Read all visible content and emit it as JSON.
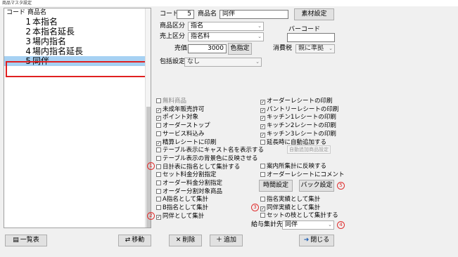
{
  "window_title": "商品マスタ設定",
  "list": {
    "header_code": "コード",
    "header_name": "商品名",
    "rows": [
      {
        "code": "1",
        "name": "本指名"
      },
      {
        "code": "2",
        "name": "本指名延長"
      },
      {
        "code": "3",
        "name": "場内指名"
      },
      {
        "code": "4",
        "name": "場内指名延長"
      },
      {
        "code": "5",
        "name": "同伴"
      }
    ],
    "selected_code": "5"
  },
  "form": {
    "code_label": "コード",
    "code_value": "5",
    "name_label": "商品名",
    "name_value": "同伴",
    "material_button": "素材設定",
    "category_label": "商品区分",
    "category_value": "指名",
    "sales_label": "売上区分",
    "sales_value": "指名料",
    "barcode_label": "バーコード",
    "barcode_value": "",
    "price_label": "売価",
    "price_value": "3000",
    "color_button": "色指定",
    "tax_label": "消費税",
    "tax_value": "親に準拠",
    "package_label": "包括設定",
    "package_value": "なし"
  },
  "checks_left": [
    {
      "label": "無料商品",
      "checked": false,
      "disabled": true
    },
    {
      "label": "未成年販売許可",
      "checked": true,
      "disabled": false
    },
    {
      "label": "ポイント対象",
      "checked": true,
      "disabled": false
    },
    {
      "label": "オーダーストップ",
      "checked": false,
      "disabled": false
    },
    {
      "label": "サービス料込み",
      "checked": false,
      "disabled": false
    },
    {
      "label": "精算レシートに印刷",
      "checked": true,
      "disabled": false
    },
    {
      "label": "テーブル表示にキャスト名を表示する",
      "checked": false,
      "disabled": false
    },
    {
      "label": "テーブル表示の背景色に反映させる",
      "checked": false,
      "disabled": false
    },
    {
      "label": "日計表に指名として集計する",
      "checked": false,
      "disabled": false
    },
    {
      "label": "セット料金分割指定",
      "checked": false,
      "disabled": false
    },
    {
      "label": "オーダー料金分割指定",
      "checked": false,
      "disabled": false
    },
    {
      "label": "オーダー分割対象商品",
      "checked": false,
      "disabled": false
    },
    {
      "label": "A指名として集計",
      "checked": false,
      "disabled": false
    },
    {
      "label": "B指名として集計",
      "checked": false,
      "disabled": false
    },
    {
      "label": "同伴として集計",
      "checked": true,
      "disabled": false
    }
  ],
  "checks_right": [
    {
      "label": "オーダーレシートの印刷",
      "checked": true,
      "disabled": false
    },
    {
      "label": "パントリーレシートの印刷",
      "checked": true,
      "disabled": false
    },
    {
      "label": "キッチン1レシートの印刷",
      "checked": true,
      "disabled": false
    },
    {
      "label": "キッチン2レシートの印刷",
      "checked": true,
      "disabled": false
    },
    {
      "label": "キッチン3レシートの印刷",
      "checked": true,
      "disabled": false
    },
    {
      "label": "延長時に自動追加する",
      "checked": false,
      "disabled": false
    }
  ],
  "auto_add_button": "自動追加商品設定",
  "checks_right_lower": [
    {
      "label": "案内所集計に反映する",
      "checked": false,
      "disabled": false
    },
    {
      "label": "オーダーレシートにコメント",
      "checked": false,
      "disabled": false
    }
  ],
  "time_button": "時間設定",
  "back_button": "バック設定",
  "checks_right_bottom": [
    {
      "label": "指名実績として集計",
      "checked": false,
      "disabled": false
    },
    {
      "label": "同伴実績として集計",
      "checked": true,
      "disabled": false
    },
    {
      "label": "セットの枝として集計する",
      "checked": false,
      "disabled": false
    }
  ],
  "salary_label": "給与集計先",
  "salary_value": "同伴",
  "markers": [
    "1",
    "2",
    "3",
    "4",
    "5"
  ],
  "footer": {
    "list_button": "一覧表",
    "move_button": "移動",
    "delete_button": "削除",
    "add_button": "追加",
    "close_button": "閉じる"
  },
  "colors": {
    "selection": "#a6d1f3",
    "marker": "#e03030",
    "close_icon": "#1f5fb4"
  }
}
